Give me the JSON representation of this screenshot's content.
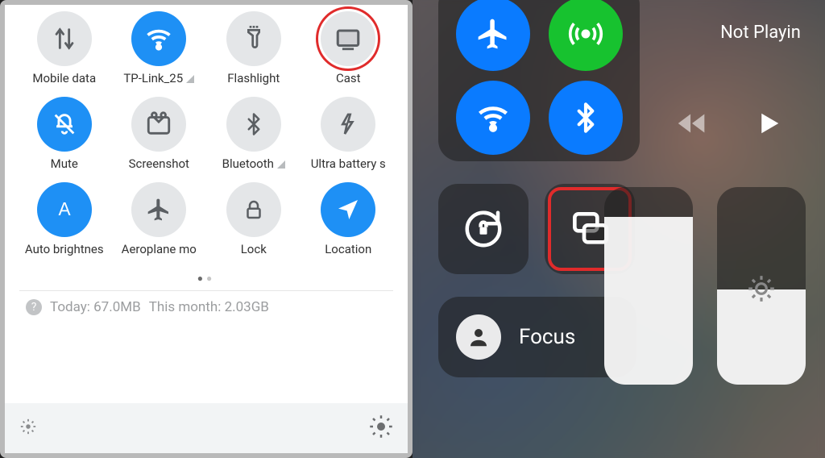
{
  "android": {
    "tiles": [
      {
        "label": "Mobile data",
        "active": false,
        "icon": "data"
      },
      {
        "label": "TP-Link_25",
        "active": true,
        "icon": "wifi",
        "signal": true
      },
      {
        "label": "Flashlight",
        "active": false,
        "icon": "flashlight"
      },
      {
        "label": "Cast",
        "active": false,
        "icon": "cast",
        "highlight": true
      },
      {
        "label": "Mute",
        "active": true,
        "icon": "mute"
      },
      {
        "label": "Screenshot",
        "active": false,
        "icon": "screenshot"
      },
      {
        "label": "Bluetooth",
        "active": false,
        "icon": "bluetooth",
        "signal": true
      },
      {
        "label": "Ultra battery s",
        "active": false,
        "icon": "battery"
      },
      {
        "label": "Auto brightnes",
        "active": true,
        "icon": "autoA"
      },
      {
        "label": "Aeroplane mo",
        "active": false,
        "icon": "airplane"
      },
      {
        "label": "Lock",
        "active": false,
        "icon": "lock"
      },
      {
        "label": "Location",
        "active": true,
        "icon": "location"
      }
    ],
    "usage_today": "Today: 67.0MB",
    "usage_month": "This month: 2.03GB"
  },
  "ios": {
    "now_playing": "Not Playin",
    "focus_label": "Focus"
  }
}
